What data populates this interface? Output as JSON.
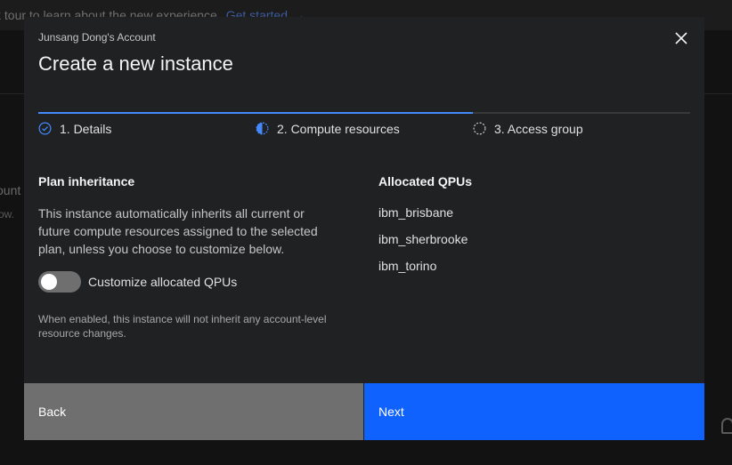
{
  "background": {
    "banner_lead": "k tour to learn about the new experience.",
    "banner_link": "Get started",
    "banner_arrow": "→",
    "fragment_1": "ount",
    "fragment_2": "ow."
  },
  "modal": {
    "label": "Junsang Dong's Account",
    "title": "Create a new instance",
    "close_icon": "close-icon"
  },
  "steps": [
    {
      "label": "1. Details",
      "state": "complete",
      "icon": "checkmark-outline-icon"
    },
    {
      "label": "2. Compute resources",
      "state": "current",
      "icon": "incomplete-half-icon"
    },
    {
      "label": "3. Access group",
      "state": "incomplete",
      "icon": "circle-dash-icon"
    }
  ],
  "plan": {
    "title": "Plan inheritance",
    "description": "This instance automatically inherits all current or future compute resources assigned to the selected plan, unless you choose to customize below.",
    "toggle_label": "Customize allocated QPUs",
    "toggle_on": false,
    "helper": "When enabled, this instance will not inherit any account-level resource changes."
  },
  "qpus": {
    "title": "Allocated QPUs",
    "items": [
      "ibm_brisbane",
      "ibm_sherbrooke",
      "ibm_torino"
    ]
  },
  "footer": {
    "back_label": "Back",
    "next_label": "Next"
  },
  "colors": {
    "accent": "#4589ff",
    "primary_button": "#0f62fe",
    "secondary_button": "#6f6f6f",
    "modal_bg": "#1f2123"
  }
}
